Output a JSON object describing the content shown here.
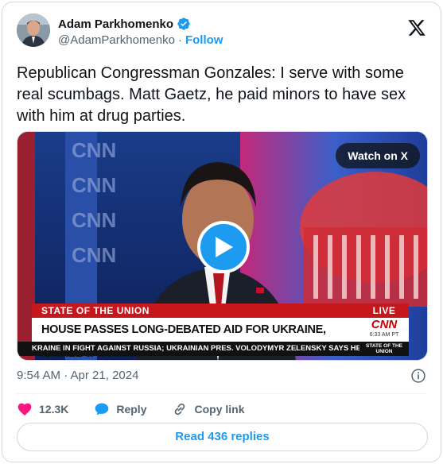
{
  "author": {
    "name": "Adam Parkhomenko",
    "handle": "@AdamParkhomenko",
    "separator": "·",
    "follow_label": "Follow"
  },
  "tweet": {
    "text": "Republican Congressman Gonzales: I serve with some real scumbags. Matt Gaetz, he paid minors to have sex with him at drug parties.",
    "timestamp": "9:54 AM · Apr 21, 2024"
  },
  "media": {
    "watch_label": "Watch on X",
    "show_name": "STATE OF THE UNION",
    "live_label": "LIVE",
    "headline": "HOUSE PASSES LONG-DEBATED AID FOR UKRAINE, ISRAEL & TAIWAN",
    "network_logo": "CNN",
    "network_time": "6:33 AM PT",
    "crawl_text": "KRAINE IN FIGHT AGAINST RUSSIA; UKRAINIAN PRES. VOLODYMYR ZELENSKY SAYS HE'S",
    "crawl_tag": "STATE OF THE UNION",
    "wall_logo": "CNN"
  },
  "actions": {
    "like_count": "12.3K",
    "reply_label": "Reply",
    "copy_label": "Copy link"
  },
  "read_replies_label": "Read 436 replies",
  "colors": {
    "accent": "#1d9bf0",
    "like": "#f91880",
    "cnn_red": "#c6171d"
  },
  "icons": {
    "verified": "verified-badge-icon",
    "x_logo": "x-logo-icon",
    "play": "play-icon",
    "info": "info-icon",
    "like": "heart-icon",
    "reply": "speech-bubble-icon",
    "copy": "link-icon"
  }
}
